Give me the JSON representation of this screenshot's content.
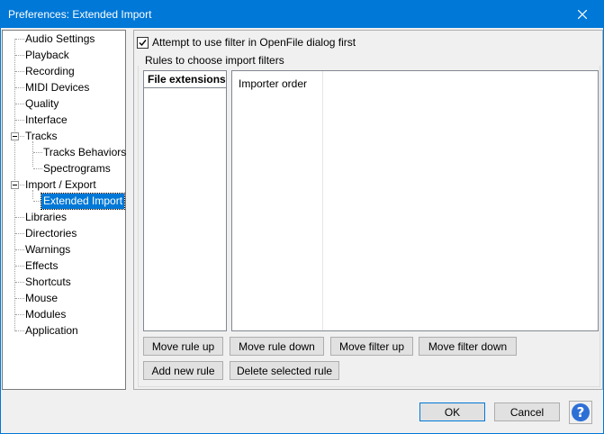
{
  "window": {
    "title": "Preferences: Extended Import"
  },
  "tree": {
    "items": [
      {
        "label": "Audio Settings"
      },
      {
        "label": "Playback"
      },
      {
        "label": "Recording"
      },
      {
        "label": "MIDI Devices"
      },
      {
        "label": "Quality"
      },
      {
        "label": "Interface"
      },
      {
        "label": "Tracks"
      },
      {
        "label": "Tracks Behaviors"
      },
      {
        "label": "Spectrograms"
      },
      {
        "label": "Import / Export"
      },
      {
        "label": "Extended Import",
        "selected": true
      },
      {
        "label": "Libraries"
      },
      {
        "label": "Directories"
      },
      {
        "label": "Warnings"
      },
      {
        "label": "Effects"
      },
      {
        "label": "Shortcuts"
      },
      {
        "label": "Mouse"
      },
      {
        "label": "Modules"
      },
      {
        "label": "Application"
      }
    ]
  },
  "panel": {
    "checkbox_label": "Attempt to use filter in OpenFile dialog first",
    "checkbox_checked": true,
    "group_label": "Rules to choose import filters",
    "ext_header": "File extensions",
    "importer_header": "Importer order",
    "buttons": {
      "move_rule_up": "Move rule up",
      "move_rule_down": "Move rule down",
      "move_filter_up": "Move filter up",
      "move_filter_down": "Move filter down",
      "add_new_rule": "Add new rule",
      "delete_selected_rule": "Delete selected rule"
    }
  },
  "footer": {
    "ok": "OK",
    "cancel": "Cancel",
    "help": "?"
  },
  "colors": {
    "titlebar": "#0078d7",
    "selection": "#0078d7",
    "help_icon": "#2e6fd6"
  }
}
